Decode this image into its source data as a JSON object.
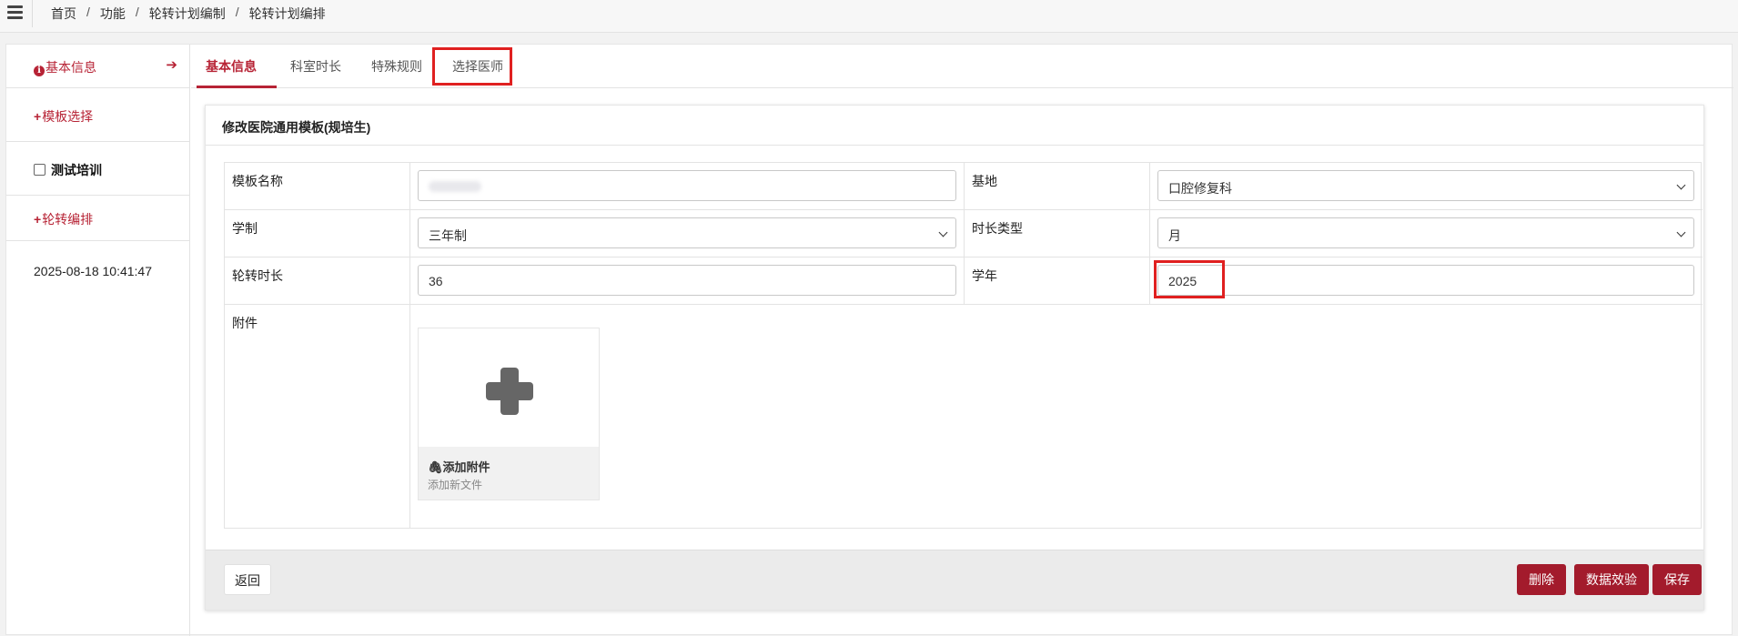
{
  "breadcrumb": [
    "首页",
    "功能",
    "轮转计划编制",
    "轮转计划编排"
  ],
  "sidebar": {
    "basic_info": "基本信息",
    "template_select": "模板选择",
    "test_training": "测试培训",
    "rotation_schedule": "轮转编排",
    "timestamp": "2025-08-18 10:41:47"
  },
  "tabs": [
    "基本信息",
    "科室时长",
    "特殊规则",
    "选择医师"
  ],
  "panel_title": "修改医院通用模板(规培生)",
  "form": {
    "template_name_label": "模板名称",
    "base_label": "基地",
    "base_value": "口腔修复科",
    "schooling_label": "学制",
    "schooling_value": "三年制",
    "duration_type_label": "时长类型",
    "duration_type_value": "月",
    "rotation_duration_label": "轮转时长",
    "rotation_duration_value": "36",
    "academic_year_label": "学年",
    "academic_year_value": "2025",
    "attachment_label": "附件",
    "add_attachment": "添加附件",
    "add_new_file": "添加新文件"
  },
  "buttons": {
    "back": "返回",
    "delete": "删除",
    "validate": "数据效验",
    "save": "保存"
  },
  "colors": {
    "accent": "#b72335",
    "button": "#a31b2c",
    "highlight": "#e02020"
  }
}
